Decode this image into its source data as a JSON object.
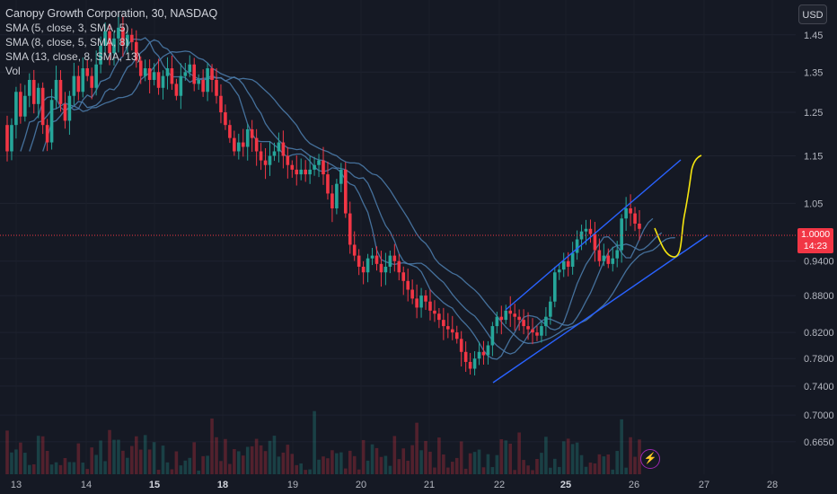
{
  "legend": {
    "title": "Canopy Growth Corporation, 30, NASDAQ",
    "indicators": [
      "SMA (5, close, 3, SMA, 5)",
      "SMA (8, close, 5, SMA, 8)",
      "SMA (13, close, 8, SMA, 13)",
      "Vol"
    ]
  },
  "currency_button": "USD",
  "current_price": {
    "value": "1.0000",
    "countdown": "14:23",
    "color": "#f23645"
  },
  "bolt_icon": "⚡",
  "colors": {
    "up": "#26a69a",
    "down": "#f23645",
    "sma": "#4a7aa8",
    "channel": "#2962ff",
    "projection": "#f5e50f",
    "background": "#151924"
  },
  "chart_data": {
    "type": "candlestick",
    "y_scale": "log",
    "ylim": [
      0.625,
      1.55
    ],
    "y_ticks": [
      "1.45",
      "1.35",
      "1.25",
      "1.15",
      "1.05",
      "0.9400",
      "0.8800",
      "0.8200",
      "0.7800",
      "0.7400",
      "0.7000",
      "0.6650"
    ],
    "x_ticks": [
      "13",
      "14",
      "15",
      "18",
      "19",
      "20",
      "21",
      "22",
      "25",
      "26",
      "27",
      "28"
    ],
    "x_tick_bold": [
      "15",
      "18",
      "25"
    ],
    "closes": [
      1.16,
      1.22,
      1.3,
      1.24,
      1.29,
      1.33,
      1.27,
      1.31,
      1.22,
      1.18,
      1.28,
      1.33,
      1.27,
      1.23,
      1.29,
      1.34,
      1.3,
      1.36,
      1.34,
      1.31,
      1.37,
      1.42,
      1.46,
      1.4,
      1.44,
      1.47,
      1.42,
      1.45,
      1.43,
      1.38,
      1.34,
      1.36,
      1.33,
      1.35,
      1.31,
      1.34,
      1.36,
      1.32,
      1.29,
      1.34,
      1.35,
      1.37,
      1.32,
      1.33,
      1.3,
      1.36,
      1.33,
      1.29,
      1.25,
      1.22,
      1.19,
      1.16,
      1.18,
      1.17,
      1.21,
      1.19,
      1.16,
      1.14,
      1.13,
      1.15,
      1.16,
      1.18,
      1.15,
      1.13,
      1.12,
      1.11,
      1.12,
      1.11,
      1.12,
      1.13,
      1.14,
      1.11,
      1.07,
      1.04,
      1.09,
      1.12,
      1.03,
      0.97,
      0.95,
      0.93,
      0.92,
      0.945,
      0.95,
      0.935,
      0.92,
      0.93,
      0.95,
      0.94,
      0.92,
      0.905,
      0.89,
      0.875,
      0.86,
      0.88,
      0.87,
      0.855,
      0.85,
      0.84,
      0.83,
      0.825,
      0.82,
      0.81,
      0.79,
      0.775,
      0.765,
      0.78,
      0.79,
      0.785,
      0.8,
      0.83,
      0.845,
      0.84,
      0.855,
      0.85,
      0.845,
      0.84,
      0.83,
      0.825,
      0.82,
      0.815,
      0.83,
      0.845,
      0.87,
      0.92,
      0.925,
      0.94,
      0.93,
      0.955,
      0.98,
      0.995,
      1.0,
      0.99,
      0.96,
      0.94,
      0.95,
      0.935,
      0.945,
      0.96,
      1.02,
      1.04,
      1.03,
      1.01,
      1.0
    ],
    "opens": [
      1.22,
      1.16,
      1.22,
      1.3,
      1.24,
      1.29,
      1.33,
      1.27,
      1.31,
      1.22,
      1.18,
      1.28,
      1.33,
      1.27,
      1.23,
      1.29,
      1.34,
      1.3,
      1.36,
      1.34,
      1.31,
      1.37,
      1.42,
      1.46,
      1.4,
      1.44,
      1.47,
      1.42,
      1.45,
      1.43,
      1.38,
      1.34,
      1.36,
      1.33,
      1.35,
      1.31,
      1.34,
      1.36,
      1.32,
      1.29,
      1.34,
      1.35,
      1.37,
      1.32,
      1.33,
      1.3,
      1.36,
      1.33,
      1.29,
      1.25,
      1.22,
      1.19,
      1.16,
      1.18,
      1.17,
      1.21,
      1.19,
      1.16,
      1.14,
      1.13,
      1.15,
      1.16,
      1.18,
      1.15,
      1.13,
      1.12,
      1.11,
      1.12,
      1.11,
      1.12,
      1.13,
      1.14,
      1.11,
      1.07,
      1.04,
      1.09,
      1.12,
      1.03,
      0.97,
      0.95,
      0.93,
      0.92,
      0.945,
      0.95,
      0.935,
      0.92,
      0.93,
      0.95,
      0.94,
      0.92,
      0.905,
      0.89,
      0.875,
      0.86,
      0.88,
      0.87,
      0.855,
      0.85,
      0.84,
      0.83,
      0.825,
      0.82,
      0.81,
      0.79,
      0.775,
      0.765,
      0.78,
      0.79,
      0.785,
      0.8,
      0.83,
      0.845,
      0.84,
      0.855,
      0.85,
      0.845,
      0.84,
      0.83,
      0.825,
      0.82,
      0.815,
      0.83,
      0.845,
      0.87,
      0.92,
      0.925,
      0.94,
      0.93,
      0.955,
      0.98,
      0.995,
      1.0,
      0.99,
      0.96,
      0.94,
      0.95,
      0.935,
      0.945,
      0.96,
      1.02,
      1.04,
      1.03,
      1.01
    ]
  }
}
